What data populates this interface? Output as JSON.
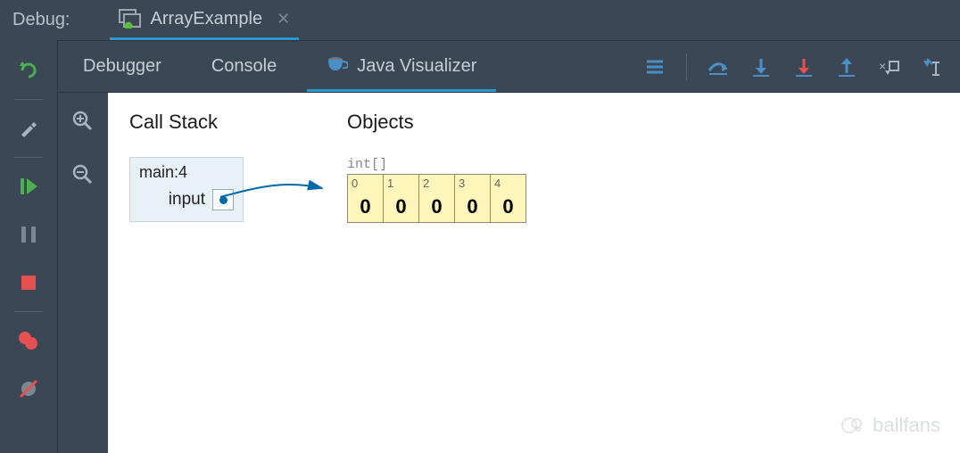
{
  "header": {
    "label": "Debug:",
    "session_name": "ArrayExample"
  },
  "tabs": {
    "debugger": "Debugger",
    "console": "Console",
    "visualizer": "Java Visualizer"
  },
  "callstack": {
    "title": "Call Stack",
    "frame_label": "main:4",
    "var_name": "input"
  },
  "objects": {
    "title": "Objects",
    "type_label": "int[]",
    "indices": [
      "0",
      "1",
      "2",
      "3",
      "4"
    ],
    "values": [
      "0",
      "0",
      "0",
      "0",
      "0"
    ]
  },
  "watermark": "ballfans"
}
